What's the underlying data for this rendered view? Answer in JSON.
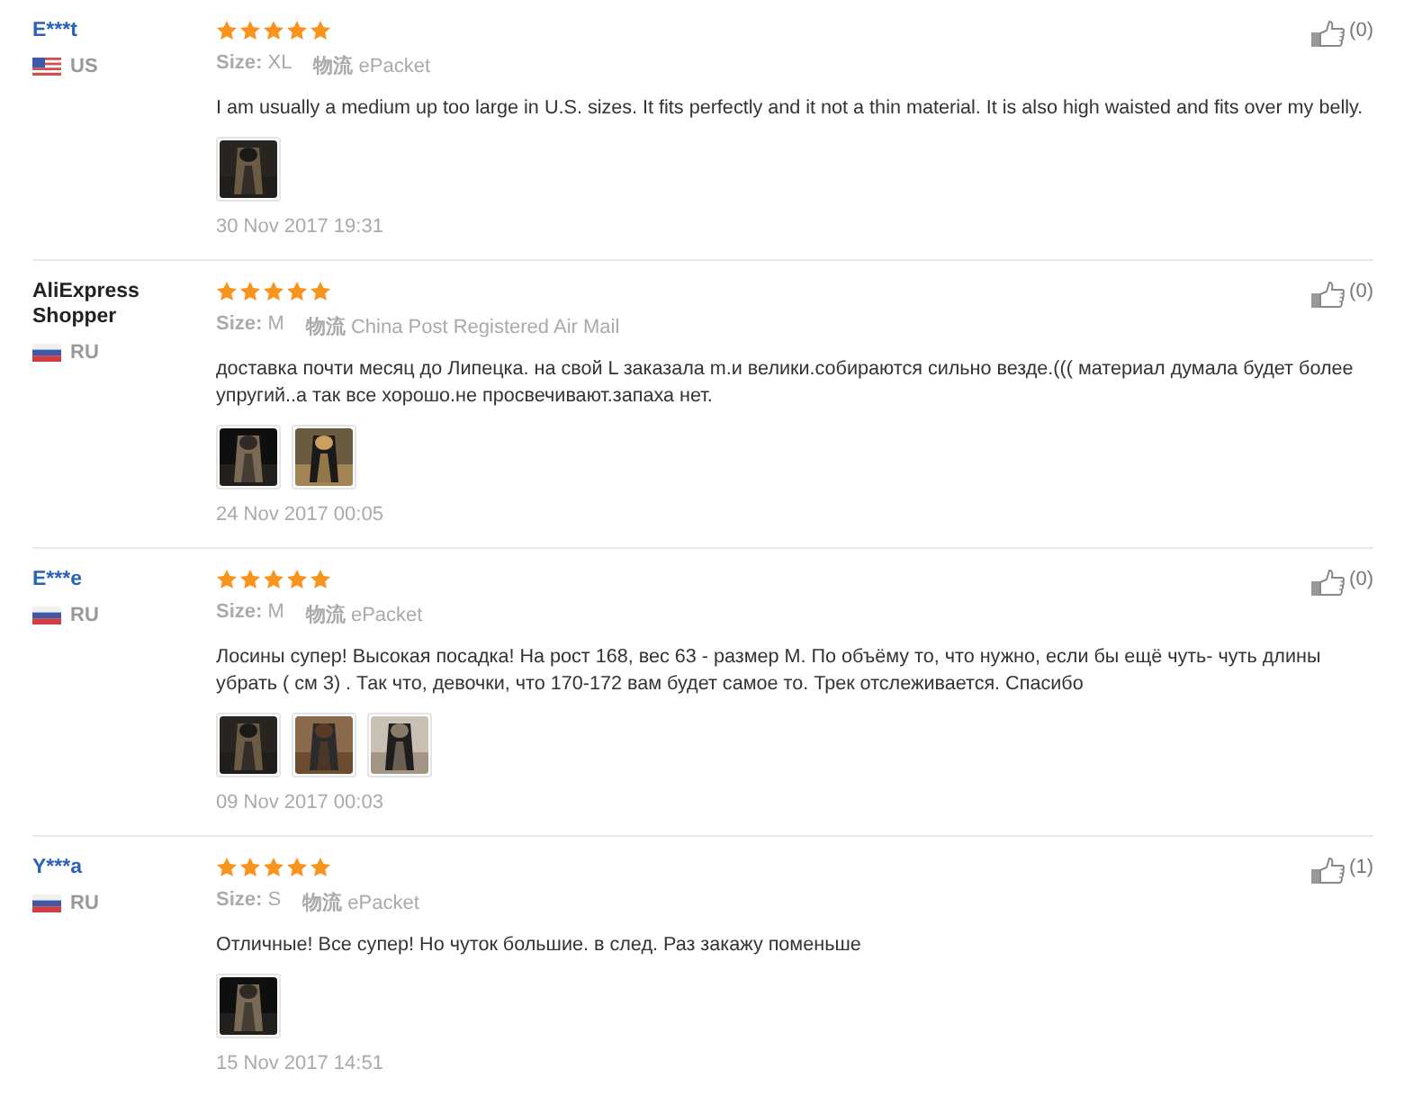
{
  "reviews": [
    {
      "name": "E***t",
      "linked": true,
      "country": "US",
      "kind": "us",
      "stars": 5,
      "size_label": "Size:",
      "size": "XL",
      "shipping_label": "物流",
      "shipping": "ePacket",
      "text": "I am usually a medium up too large in U.S. sizes. It fits perfectly and it not a thin material. It is also high waisted and fits over my belly.",
      "photos": [
        {
          "kind": "picture"
        }
      ],
      "date": "30 Nov 2017 19:31",
      "likes": "(0)"
    },
    {
      "name": "AliExpress Shopper",
      "linked": false,
      "country": "RU",
      "kind": "ru",
      "stars": 5,
      "size_label": "Size:",
      "size": "M",
      "shipping_label": "物流",
      "shipping": "China Post Registered Air Mail",
      "text": "доставка почти месяц до Липецка. на свой L заказала m.и велики.собираются сильно везде.((( материал думала будет более упругий..а так все хорошо.не просвечивают.запаха нет.",
      "photos": [
        {
          "kind": "picture"
        },
        {
          "kind": "picture"
        }
      ],
      "date": "24 Nov 2017 00:05",
      "likes": "(0)"
    },
    {
      "name": "E***e",
      "linked": true,
      "country": "RU",
      "kind": "ru",
      "stars": 5,
      "size_label": "Size:",
      "size": "M",
      "shipping_label": "物流",
      "shipping": "ePacket",
      "text": "Лосины супер! Высокая посадка! На рост 168, вес 63 - размер М. По объёму то, что нужно, если бы ещё чуть- чуть длины убрать ( см 3) . Так что, девочки, что 170-172 вам будет самое то. Трек отслеживается. Спасибо",
      "photos": [
        {
          "kind": "picture"
        },
        {
          "kind": "picture"
        },
        {
          "kind": "picture"
        }
      ],
      "date": "09 Nov 2017 00:03",
      "likes": "(0)"
    },
    {
      "name": "Y***a",
      "linked": true,
      "country": "RU",
      "kind": "ru",
      "stars": 5,
      "size_label": "Size:",
      "size": "S",
      "shipping_label": "物流",
      "shipping": "ePacket",
      "text": "Отличные! Все супер! Но чуток большие. в след. Раз закажу поменьше",
      "photos": [
        {
          "kind": "picture"
        }
      ],
      "date": "15 Nov 2017 14:51",
      "likes": "(1)"
    }
  ]
}
